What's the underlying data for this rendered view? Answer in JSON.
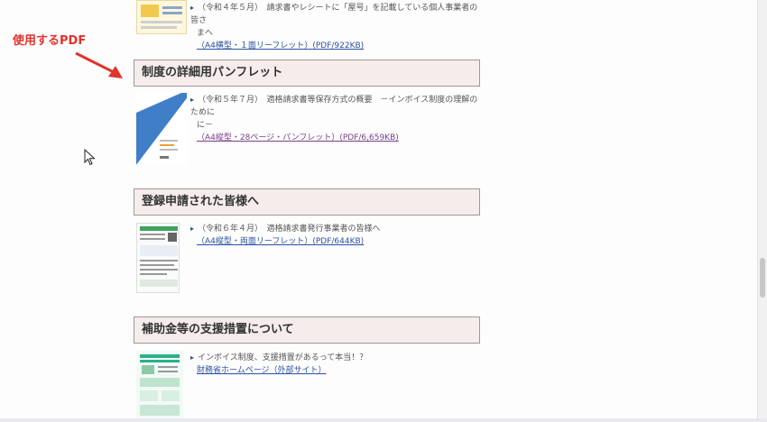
{
  "annotation": {
    "label": "使用するPDF",
    "color": "#e2322b"
  },
  "top_entry": {
    "text": "（令和４年５月）　請求書やレシートに「屋号」を記載している個人事業者の皆さ",
    "text_cont": "まへ",
    "link": "（A4横型・１面リーフレット）(PDF/922KB)"
  },
  "sections": [
    {
      "title": "制度の詳細用パンフレット",
      "text": "（令和５年７月）　適格請求書等保存方式の概要　－インボイス制度の理解のために",
      "text_cont": "に－",
      "link": "（A4縦型・28ページ・パンフレット）(PDF/6,659KB)"
    },
    {
      "title": "登録申請された皆様へ",
      "text": "（令和６年４月）　適格請求書発行事業者の皆様へ",
      "link": "（A4縦型・両面リーフレット）(PDF/644KB)"
    },
    {
      "title": "補助金等の支援措置について",
      "text": "インボイス制度、支援措置があるって本当！？",
      "link": "財務省ホームページ（外部サイト）"
    }
  ],
  "colors": {
    "header_bg": "#f6ecec",
    "link": "#2b52a2",
    "visited_link": "#7a3e8c"
  }
}
